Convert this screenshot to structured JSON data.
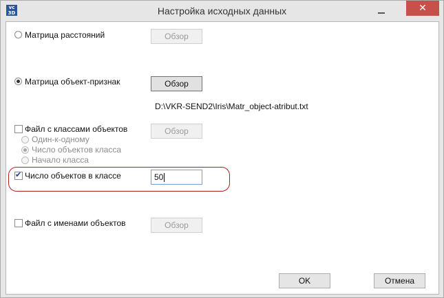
{
  "window": {
    "title": "Настройка исходных данных",
    "icon_text": "vc 3D",
    "close_symbol": "✕"
  },
  "options": {
    "distance_matrix": {
      "label": "Матрица расстояний",
      "checked": false,
      "browse_label": "Обзор",
      "browse_enabled": false
    },
    "object_feature_matrix": {
      "label": "Матрица объект-признак",
      "checked": true,
      "browse_label": "Обзор",
      "browse_enabled": true,
      "file_path": "D:\\VKR-SEND2\\Iris\\Matr_object-atribut.txt"
    },
    "class_file": {
      "label": "Файл с классами объектов",
      "checked": false,
      "browse_label": "Обзор",
      "browse_enabled": false,
      "sub_options": [
        {
          "label": "Один-к-одному",
          "checked": false
        },
        {
          "label": "Число объектов класса",
          "checked": true
        },
        {
          "label": "Начало класса",
          "checked": false
        }
      ]
    },
    "objects_per_class": {
      "label": "Число объектов в классе",
      "checked": true,
      "value": "50"
    },
    "object_names_file": {
      "label": "Файл с именами объектов",
      "checked": false,
      "browse_label": "Обзор",
      "browse_enabled": false
    }
  },
  "footer": {
    "ok_label": "OK",
    "cancel_label": "Отмена"
  },
  "colors": {
    "highlight": "#b01e1e",
    "close_button": "#c7504a"
  }
}
